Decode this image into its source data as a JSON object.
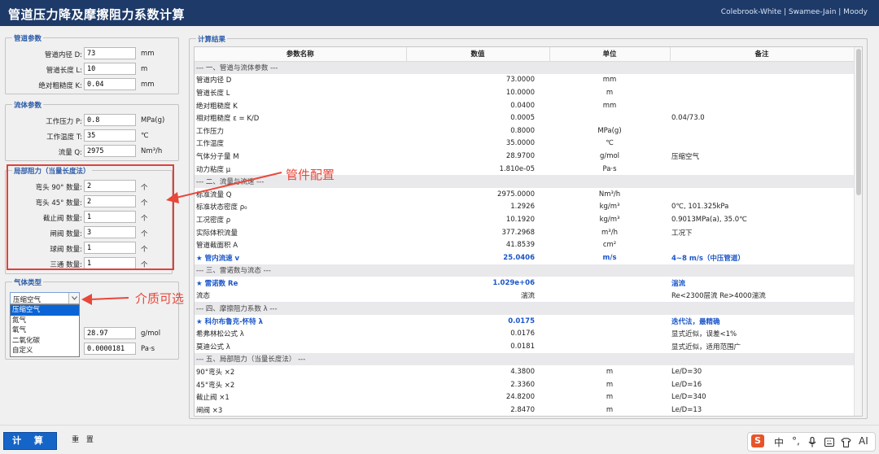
{
  "window": {
    "title": "管道压力降及摩擦阻力系数计算",
    "methods": "Colebrook-White | Swamee-Jain | Moody"
  },
  "pipe_params": {
    "legend": "管道参数",
    "fields": [
      {
        "label": "管道内径 D:",
        "value": "73",
        "unit": "mm"
      },
      {
        "label": "管道长度 L:",
        "value": "10",
        "unit": "m"
      },
      {
        "label": "绝对粗糙度 K:",
        "value": "0.04",
        "unit": "mm"
      }
    ]
  },
  "fluid_params": {
    "legend": "流体参数",
    "fields": [
      {
        "label": "工作压力 P:",
        "value": "0.8",
        "unit": "MPa(g)"
      },
      {
        "label": "工作温度 T:",
        "value": "35",
        "unit": "℃"
      },
      {
        "label": "流量 Q:",
        "value": "2975",
        "unit": "Nm³/h"
      }
    ]
  },
  "local_resistance": {
    "legend": "局部阻力（当量长度法）",
    "fields": [
      {
        "label": "弯头 90° 数量:",
        "value": "2",
        "unit": "个"
      },
      {
        "label": "弯头 45° 数量:",
        "value": "2",
        "unit": "个"
      },
      {
        "label": "截止阀 数量:",
        "value": "1",
        "unit": "个"
      },
      {
        "label": "闸阀 数量:",
        "value": "3",
        "unit": "个"
      },
      {
        "label": "球阀 数量:",
        "value": "1",
        "unit": "个"
      },
      {
        "label": "三通 数量:",
        "value": "1",
        "unit": "个"
      }
    ]
  },
  "gas_type": {
    "legend": "气体类型",
    "selected": "压缩空气",
    "options": [
      "压缩空气",
      "氮气",
      "氧气",
      "二氧化碳",
      "自定义"
    ],
    "fields": [
      {
        "value": "28.97",
        "unit": "g/mol"
      },
      {
        "value": "0.0000181",
        "unit": "Pa·s"
      }
    ]
  },
  "results": {
    "legend": "计算结果",
    "headers": [
      "参数名称",
      "数值",
      "单位",
      "备注"
    ],
    "rows": [
      {
        "type": "section",
        "name": "--- 一、管道与流体参数 ---"
      },
      {
        "name": "管道内径 D",
        "value": "73.0000",
        "unit": "mm",
        "note": ""
      },
      {
        "name": "管道长度 L",
        "value": "10.0000",
        "unit": "m",
        "note": ""
      },
      {
        "name": "绝对粗糙度 K",
        "value": "0.0400",
        "unit": "mm",
        "note": ""
      },
      {
        "name": "相对粗糙度 ε = K/D",
        "value": "0.0005",
        "unit": "",
        "note": "0.04/73.0"
      },
      {
        "name": "工作压力",
        "value": "0.8000",
        "unit": "MPa(g)",
        "note": ""
      },
      {
        "name": "工作温度",
        "value": "35.0000",
        "unit": "℃",
        "note": ""
      },
      {
        "name": "气体分子量 M",
        "value": "28.9700",
        "unit": "g/mol",
        "note": "压缩空气"
      },
      {
        "name": "动力粘度 μ",
        "value": "1.810e-05",
        "unit": "Pa·s",
        "note": ""
      },
      {
        "type": "section",
        "name": "--- 二、流量与流速 ---"
      },
      {
        "name": "标准流量 Q",
        "value": "2975.0000",
        "unit": "Nm³/h",
        "note": ""
      },
      {
        "name": "标准状态密度 ρ₀",
        "value": "1.2926",
        "unit": "kg/m³",
        "note": "0℃, 101.325kPa"
      },
      {
        "name": "工况密度 ρ",
        "value": "10.1920",
        "unit": "kg/m³",
        "note": "0.9013MPa(a), 35.0℃"
      },
      {
        "name": "实际体积流量",
        "value": "377.2968",
        "unit": "m³/h",
        "note": "工况下"
      },
      {
        "name": "管道截面积 A",
        "value": "41.8539",
        "unit": "cm²",
        "note": ""
      },
      {
        "type": "hl",
        "name": "★ 管内流速 v",
        "value": "25.0406",
        "unit": "m/s",
        "note": "4~8 m/s（中压管道）"
      },
      {
        "type": "section",
        "name": "--- 三、雷诺数与流态 ---"
      },
      {
        "type": "hl",
        "name": "★ 雷诺数 Re",
        "value": "1.029e+06",
        "unit": "",
        "note": "湍流"
      },
      {
        "name": "流态",
        "value": "湍流",
        "unit": "",
        "note": "Re<2300层流 Re>4000湍流"
      },
      {
        "type": "section",
        "name": "--- 四、摩擦阻力系数 λ ---"
      },
      {
        "type": "hl",
        "name": "★ 科尔布鲁克-怀特 λ",
        "value": "0.0175",
        "unit": "",
        "note": "迭代法，最精确"
      },
      {
        "name": "  希弗林松公式 λ",
        "value": "0.0176",
        "unit": "",
        "note": "显式近似，误差<1%"
      },
      {
        "name": "  莫迪公式 λ",
        "value": "0.0181",
        "unit": "",
        "note": "显式近似，适用范围广"
      },
      {
        "type": "section",
        "name": "--- 五、局部阻力（当量长度法） ---"
      },
      {
        "name": "  90°弯头 ×2",
        "value": "4.3800",
        "unit": "m",
        "note": "Le/D=30"
      },
      {
        "name": "  45°弯头 ×2",
        "value": "2.3360",
        "unit": "m",
        "note": "Le/D=16"
      },
      {
        "name": "  截止阀 ×1",
        "value": "24.8200",
        "unit": "m",
        "note": "Le/D=340"
      },
      {
        "name": "  闸阀 ×3",
        "value": "2.8470",
        "unit": "m",
        "note": "Le/D=13"
      }
    ]
  },
  "buttons": {
    "calc": "计 算",
    "reset": "重 置"
  },
  "annotations": {
    "fittings": "管件配置",
    "medium": "介质可选"
  },
  "ime": {
    "items": [
      "中",
      "°,",
      "AI"
    ]
  },
  "colors": {
    "titlebar": "#1e3a68",
    "accent": "#1565c8",
    "highlight_text": "#1a56c8",
    "annotation": "#e8473a"
  }
}
